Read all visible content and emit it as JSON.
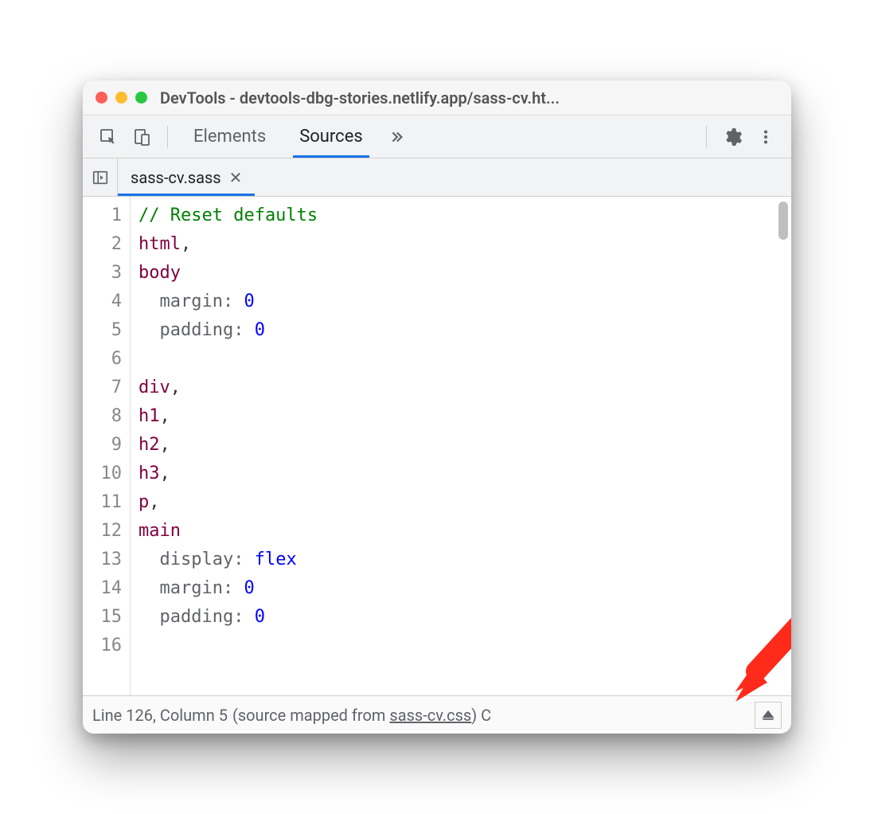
{
  "window": {
    "title": "DevTools - devtools-dbg-stories.netlify.app/sass-cv.ht..."
  },
  "panelTabs": {
    "elements": "Elements",
    "sources": "Sources"
  },
  "fileTab": {
    "name": "sass-cv.sass"
  },
  "code": {
    "lines": [
      {
        "n": "1",
        "html": "<span class='comment'>// Reset defaults</span>"
      },
      {
        "n": "2",
        "html": "<span class='selector'>html</span><span class='comma'>,</span>"
      },
      {
        "n": "3",
        "html": "<span class='selector'>body</span>"
      },
      {
        "n": "4",
        "html": "  <span class='prop'>margin:</span> <span class='value'>0</span>"
      },
      {
        "n": "5",
        "html": "  <span class='prop'>padding:</span> <span class='value'>0</span>"
      },
      {
        "n": "6",
        "html": ""
      },
      {
        "n": "7",
        "html": "<span class='selector'>div</span><span class='comma'>,</span>"
      },
      {
        "n": "8",
        "html": "<span class='selector'>h1</span><span class='comma'>,</span>"
      },
      {
        "n": "9",
        "html": "<span class='selector'>h2</span><span class='comma'>,</span>"
      },
      {
        "n": "10",
        "html": "<span class='selector'>h3</span><span class='comma'>,</span>"
      },
      {
        "n": "11",
        "html": "<span class='selector'>p</span><span class='comma'>,</span>"
      },
      {
        "n": "12",
        "html": "<span class='selector'>main</span>"
      },
      {
        "n": "13",
        "html": "  <span class='prop'>display:</span> <span class='value'>flex</span>"
      },
      {
        "n": "14",
        "html": "  <span class='prop'>margin:</span> <span class='value'>0</span>"
      },
      {
        "n": "15",
        "html": "  <span class='prop'>padding:</span> <span class='value'>0</span>"
      },
      {
        "n": "16",
        "html": ""
      }
    ]
  },
  "status": {
    "position": "Line 126, Column 5",
    "mapped_prefix": "(source mapped from ",
    "mapped_link": "sass-cv.css",
    "mapped_suffix": ")",
    "trailing": " C"
  }
}
